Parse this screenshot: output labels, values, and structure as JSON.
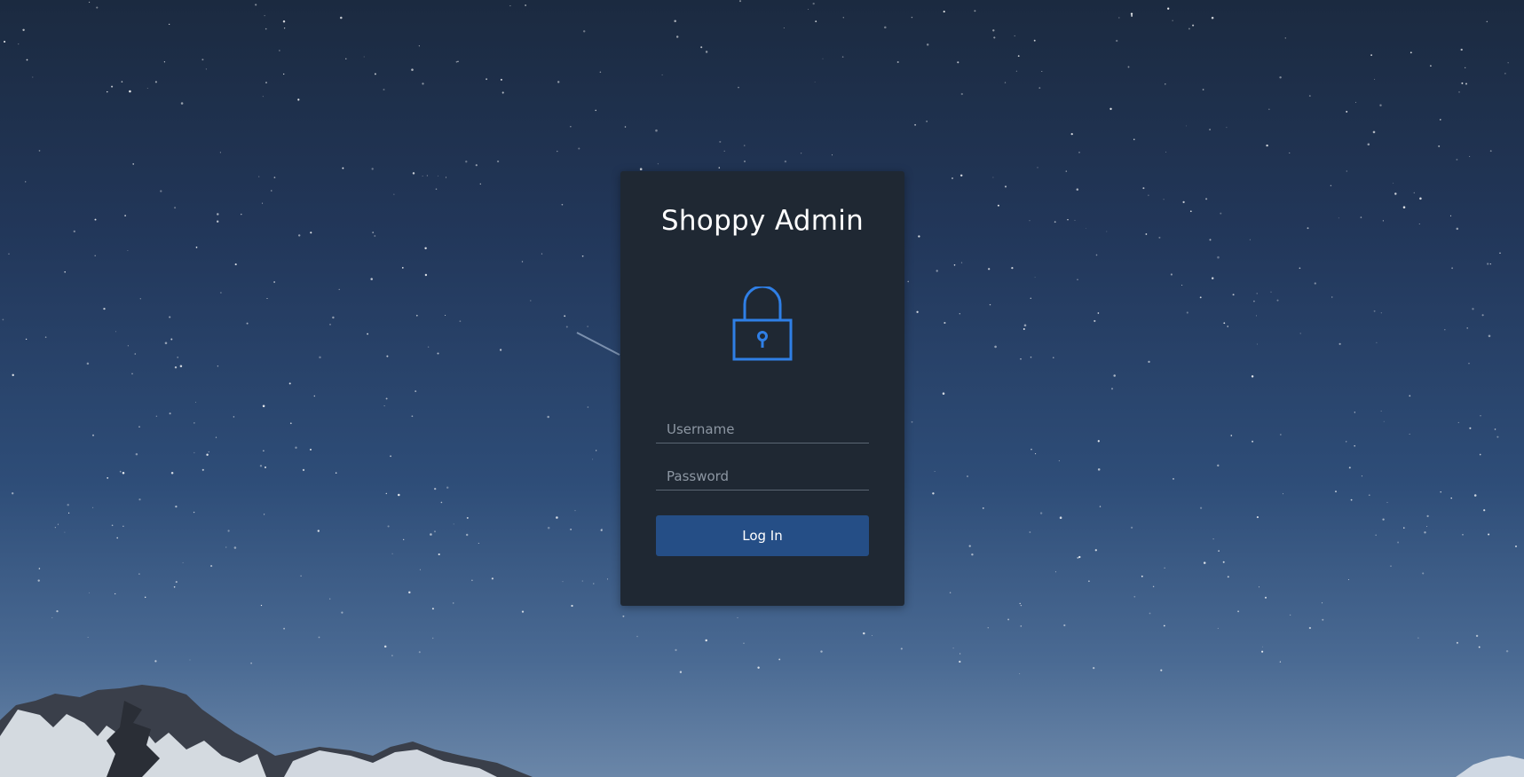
{
  "login": {
    "title": "Shoppy Admin",
    "icon": "lock-icon",
    "username_placeholder": "Username",
    "password_placeholder": "Password",
    "button_label": "Log In"
  },
  "colors": {
    "card_background": "#1f2833",
    "accent": "#2f7fe6",
    "button": "#254e86",
    "sky_top": "#1b2a40",
    "sky_bottom": "#6a86a8"
  }
}
